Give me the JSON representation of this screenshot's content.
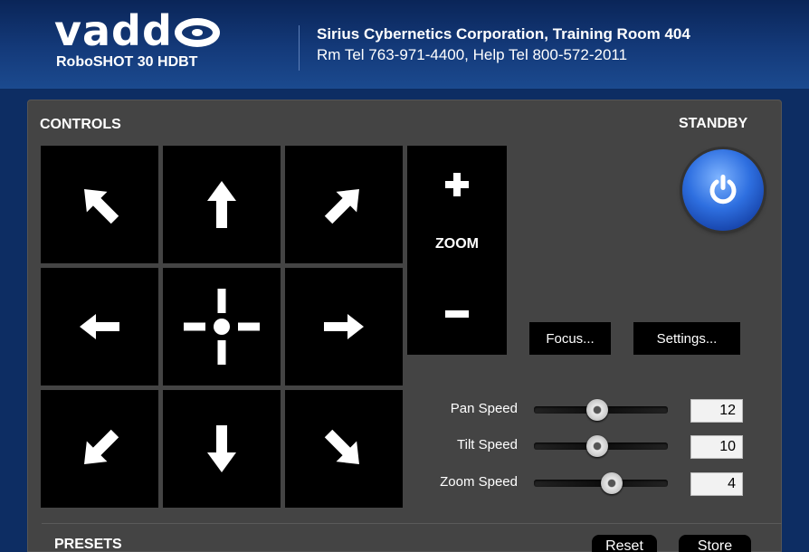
{
  "header": {
    "brand": "vadd",
    "model": "RoboSHOT 30 HDBT",
    "organization": "Sirius Cybernetics Corporation, Training Room 404",
    "phone_line": "Rm Tel 763-971-4400, Help Tel 800-572-2011"
  },
  "controls": {
    "title": "CONTROLS",
    "zoom_label": "ZOOM",
    "focus_label": "Focus...",
    "settings_label": "Settings..."
  },
  "standby": {
    "title": "STANDBY"
  },
  "speeds": [
    {
      "label": "Pan Speed",
      "value": "12",
      "level": 0.47
    },
    {
      "label": "Tilt Speed",
      "value": "10",
      "level": 0.47
    },
    {
      "label": "Zoom Speed",
      "value": "4",
      "level": 0.58
    }
  ],
  "presets": {
    "title": "PRESETS",
    "reset_label": "Reset",
    "store_label": "Store"
  },
  "icons": {
    "up_left": "arrow-up-left-icon",
    "up": "arrow-up-icon",
    "up_right": "arrow-up-right-icon",
    "left": "arrow-left-icon",
    "home": "crosshair-home-icon",
    "right": "arrow-right-icon",
    "down_left": "arrow-down-left-icon",
    "down": "arrow-down-icon",
    "down_right": "arrow-down-right-icon",
    "zoom_in": "plus-icon",
    "zoom_out": "minus-icon",
    "standby": "power-icon"
  },
  "colors": {
    "header_blue": "#143a7a",
    "panel_gray": "#444444",
    "button_black": "#000000",
    "standby_blue": "#2e6fe0"
  }
}
